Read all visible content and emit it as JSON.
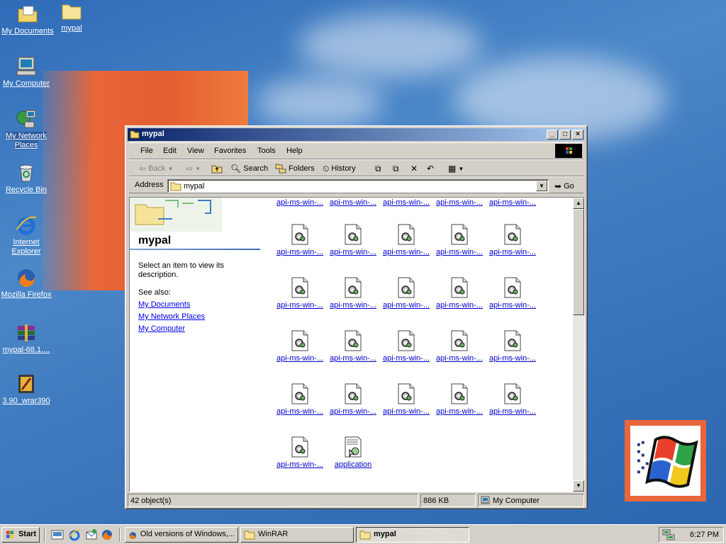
{
  "desktop": {
    "icons": [
      {
        "label": "My Documents"
      },
      {
        "label": "mypal"
      },
      {
        "label": "My Computer"
      },
      {
        "label": "My Network Places"
      },
      {
        "label": "Recycle Bin"
      },
      {
        "label": "Internet Explorer"
      },
      {
        "label": "Mozilla Firefox"
      },
      {
        "label": "mypal-68.1...."
      },
      {
        "label": "3.90_wrar390"
      }
    ]
  },
  "window": {
    "title": "mypal",
    "min": "_",
    "max": "□",
    "close": "×",
    "menu": [
      "File",
      "Edit",
      "View",
      "Favorites",
      "Tools",
      "Help"
    ],
    "toolbar": {
      "back": "Back",
      "search": "Search",
      "folders": "Folders",
      "history": "History"
    },
    "address": {
      "label": "Address",
      "value": "mypal",
      "go": "Go"
    },
    "left_pane": {
      "title": "mypal",
      "description": "Select an item to view its description.",
      "see_also": "See also:",
      "links": [
        "My Documents",
        "My Network Places",
        "My Computer"
      ]
    },
    "files": {
      "top_row": [
        "api-ms-win-...",
        "api-ms-win-...",
        "api-ms-win-...",
        "api-ms-win-...",
        "api-ms-win-..."
      ],
      "rows": [
        [
          "api-ms-win-...",
          "api-ms-win-...",
          "api-ms-win-...",
          "api-ms-win-...",
          "api-ms-win-..."
        ],
        [
          "api-ms-win-...",
          "api-ms-win-...",
          "api-ms-win-...",
          "api-ms-win-...",
          "api-ms-win-..."
        ],
        [
          "api-ms-win-...",
          "api-ms-win-...",
          "api-ms-win-...",
          "api-ms-win-...",
          "api-ms-win-..."
        ],
        [
          "api-ms-win-...",
          "api-ms-win-...",
          "api-ms-win-...",
          "api-ms-win-...",
          "api-ms-win-..."
        ],
        [
          "api-ms-win-...",
          "application"
        ]
      ]
    },
    "status": {
      "objects": "42 object(s)",
      "size": "886 KB",
      "zone": "My Computer"
    }
  },
  "taskbar": {
    "start": "Start",
    "tasks": [
      {
        "label": "Old versions of Windows,..."
      },
      {
        "label": "WinRAR"
      },
      {
        "label": "mypal"
      }
    ],
    "clock": "6:27 PM"
  },
  "colors": {
    "desktop": "#3a74bb",
    "titlebar_start": "#0a246a",
    "titlebar_end": "#a6caf0",
    "chrome": "#d4d0c8",
    "link": "#0000cc"
  }
}
